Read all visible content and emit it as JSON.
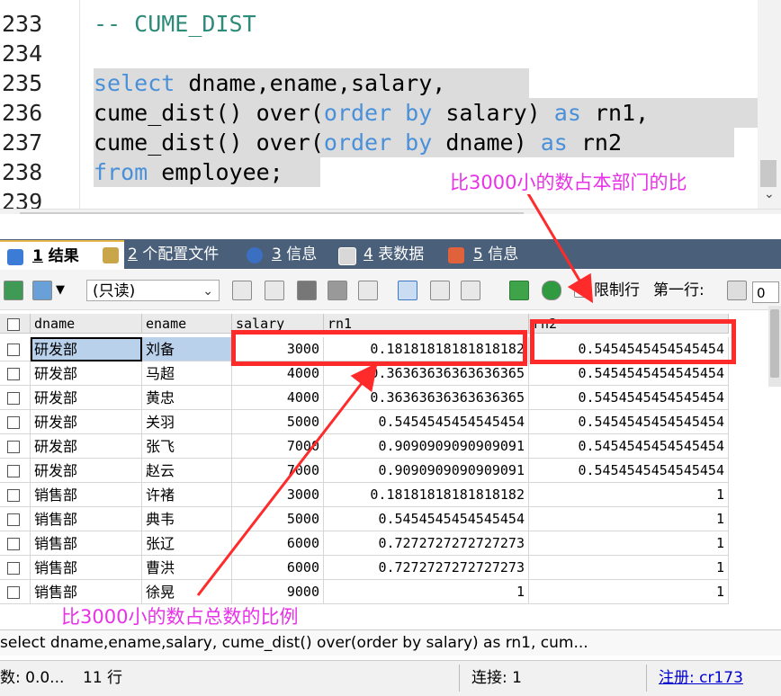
{
  "editor": {
    "line_numbers": [
      "233",
      "234",
      "235",
      "236",
      "237",
      "238",
      "239"
    ],
    "line233": "-- CUME_DIST",
    "line235": {
      "k1": "select",
      "t1": " dname,ename,salary,"
    },
    "line236": {
      "t1": "cume_dist() over(",
      "k1": "order by",
      "t2": " salary) ",
      "k2": "as",
      "t3": " rn1,"
    },
    "line237": {
      "t1": "cume_dist() over(",
      "k1": "order by",
      "t2": " dname) ",
      "k2": "as",
      "t3": " rn2 "
    },
    "line238": {
      "k1": "from",
      "t1": " employee;"
    }
  },
  "tabs": [
    {
      "num": "1",
      "label": "结果"
    },
    {
      "num": "2",
      "label": "个配置文件"
    },
    {
      "num": "3",
      "label": "信息"
    },
    {
      "num": "4",
      "label": "表数据"
    },
    {
      "num": "5",
      "label": "信息"
    }
  ],
  "toolbar": {
    "mode_select": "(只读)",
    "limit_rows_label": "限制行",
    "first_row_label": "第一行:",
    "first_row_value": "0"
  },
  "grid": {
    "columns": [
      "dname",
      "ename",
      "salary",
      "rn1",
      "rn2"
    ],
    "rows": [
      [
        "研发部",
        "刘备",
        "3000",
        "0.18181818181818182",
        "0.5454545454545454"
      ],
      [
        "研发部",
        "马超",
        "4000",
        "0.36363636363636365",
        "0.5454545454545454"
      ],
      [
        "研发部",
        "黄忠",
        "4000",
        "0.36363636363636365",
        "0.5454545454545454"
      ],
      [
        "研发部",
        "关羽",
        "5000",
        "0.5454545454545454",
        "0.5454545454545454"
      ],
      [
        "研发部",
        "张飞",
        "7000",
        "0.9090909090909091",
        "0.5454545454545454"
      ],
      [
        "研发部",
        "赵云",
        "7000",
        "0.9090909090909091",
        "0.5454545454545454"
      ],
      [
        "销售部",
        "许褚",
        "3000",
        "0.18181818181818182",
        "1"
      ],
      [
        "销售部",
        "典韦",
        "5000",
        "0.5454545454545454",
        "1"
      ],
      [
        "销售部",
        "张辽",
        "6000",
        "0.7272727272727273",
        "1"
      ],
      [
        "销售部",
        "曹洪",
        "6000",
        "0.7272727272727273",
        "1"
      ],
      [
        "销售部",
        "徐晃",
        "9000",
        "1",
        "1"
      ]
    ]
  },
  "annotations": {
    "top": "比3000小的数占本部门的比",
    "bottom": "比3000小的数占总数的比例",
    "color": "#e832e8",
    "box_color": "#ff2a2a"
  },
  "sqlbar": "select dname,ename,salary, cume_dist() over(order by salary) as rn1, cum...",
  "status": {
    "left": "数: 0.0...",
    "rows": "11 行",
    "connection": "连接: 1",
    "register": "注册:  cr173"
  }
}
